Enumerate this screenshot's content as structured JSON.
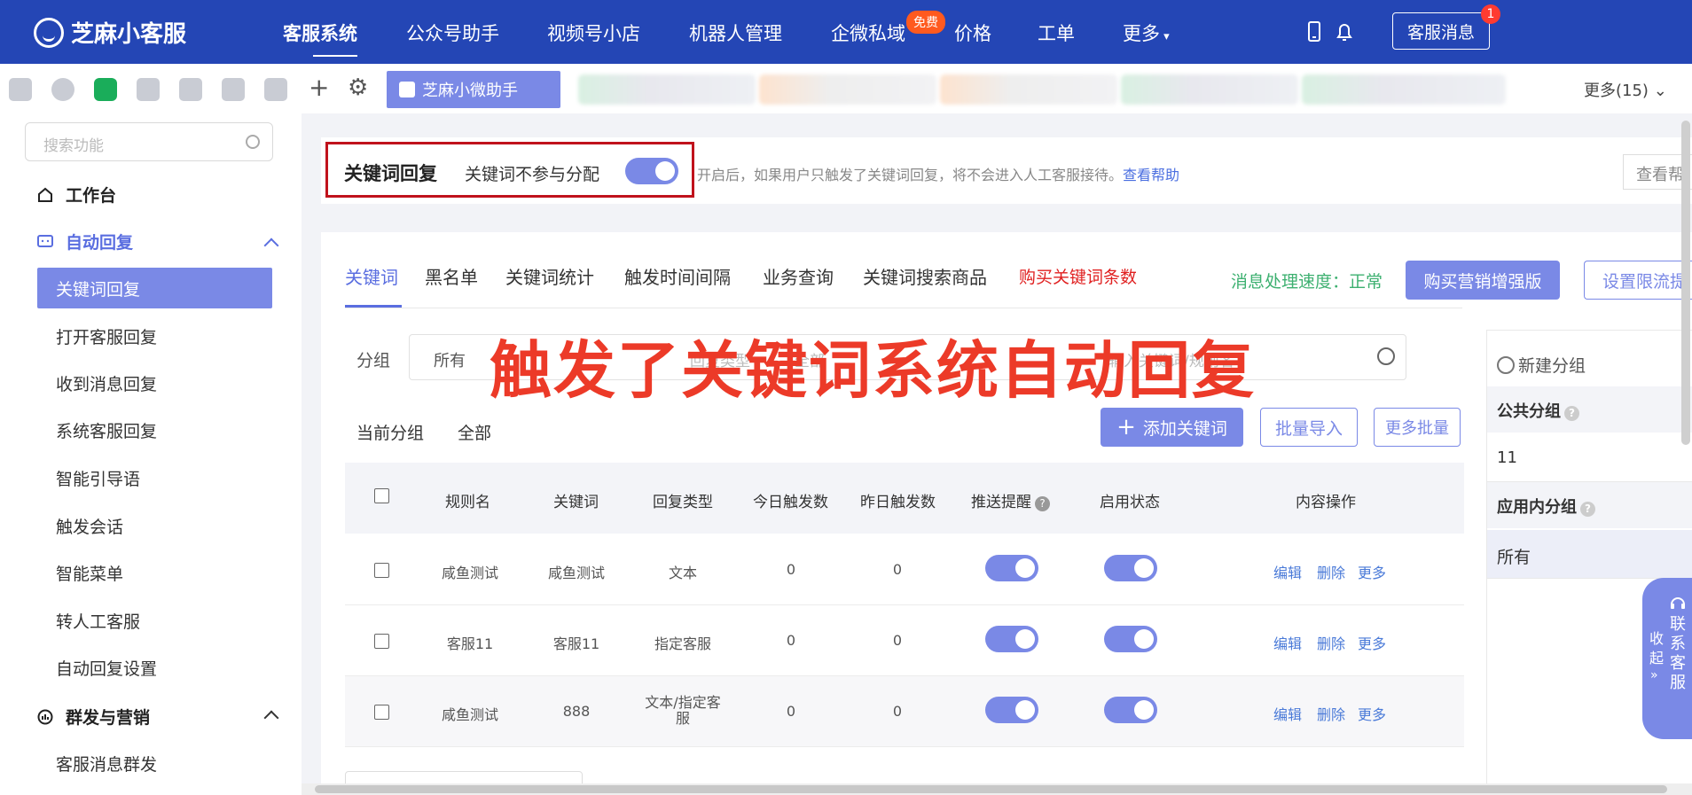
{
  "topnav": {
    "logo": "芝麻小客服",
    "items": [
      "客服系统",
      "公众号助手",
      "视频号小店",
      "机器人管理",
      "企微私域",
      "价格",
      "工单",
      "更多"
    ],
    "free_badge": "免费",
    "kf_button": "客服消息",
    "kf_badge": "1"
  },
  "toolbar": {
    "app_tab": "芝麻小微助手",
    "more": "更多(15)"
  },
  "sidebar": {
    "search_placeholder": "搜索功能",
    "workbench": "工作台",
    "group_auto": "自动回复",
    "auto_items": [
      "关键词回复",
      "打开客服回复",
      "收到消息回复",
      "系统客服回复",
      "智能引导语",
      "触发会话",
      "智能菜单",
      "转人工客服",
      "自动回复设置"
    ],
    "group_mass": "群发与营销",
    "mass_items": [
      "客服消息群发"
    ]
  },
  "header": {
    "title": "关键词回复",
    "switch_label": "关键词不参与分配",
    "hint": "开启后，如果用户只触发了关键词回复，将不会进入人工客服接待。",
    "hint_link": "查看帮助",
    "help_button": "查看帮"
  },
  "tabs": [
    "关键词",
    "黑名单",
    "关键词统计",
    "触发时间间隔",
    "业务查询",
    "关键词搜索商品",
    "购买关键词条数"
  ],
  "status": {
    "speed": "消息处理速度：正常",
    "buy_button": "购买营销增强版",
    "limit_button": "设置限流提"
  },
  "filter": {
    "label": "分组",
    "value": "所有",
    "type_placeholder": "回复类型",
    "all": "全部",
    "search_placeholder": "输入关键词/规则名"
  },
  "overlay_text": "触发了关键词系统自动回复",
  "segments": {
    "current": "当前分组",
    "all": "全部",
    "add": "添加关键词",
    "import": "批量导入",
    "more": "更多批量"
  },
  "table": {
    "headers": [
      "规则名",
      "关键词",
      "回复类型",
      "今日触发数",
      "昨日触发数",
      "推送提醒",
      "启用状态",
      "内容操作"
    ],
    "rows": [
      {
        "name": "咸鱼测试",
        "keyword": "咸鱼测试",
        "type": "文本",
        "today": "0",
        "yesterday": "0"
      },
      {
        "name": "客服11",
        "keyword": "客服11",
        "type": "指定客服",
        "today": "0",
        "yesterday": "0"
      },
      {
        "name": "咸鱼测试",
        "keyword": "888",
        "type": "文本/指定客服",
        "today": "0",
        "yesterday": "0"
      }
    ],
    "ops": [
      "编辑",
      "删除",
      "更多"
    ]
  },
  "right_panel": {
    "new_group": "新建分组",
    "public_group": "公共分组",
    "public_value": "11",
    "app_group": "应用内分组",
    "app_value": "所有"
  },
  "float_widget": {
    "collapse": "收起",
    "contact": "联系客服"
  }
}
